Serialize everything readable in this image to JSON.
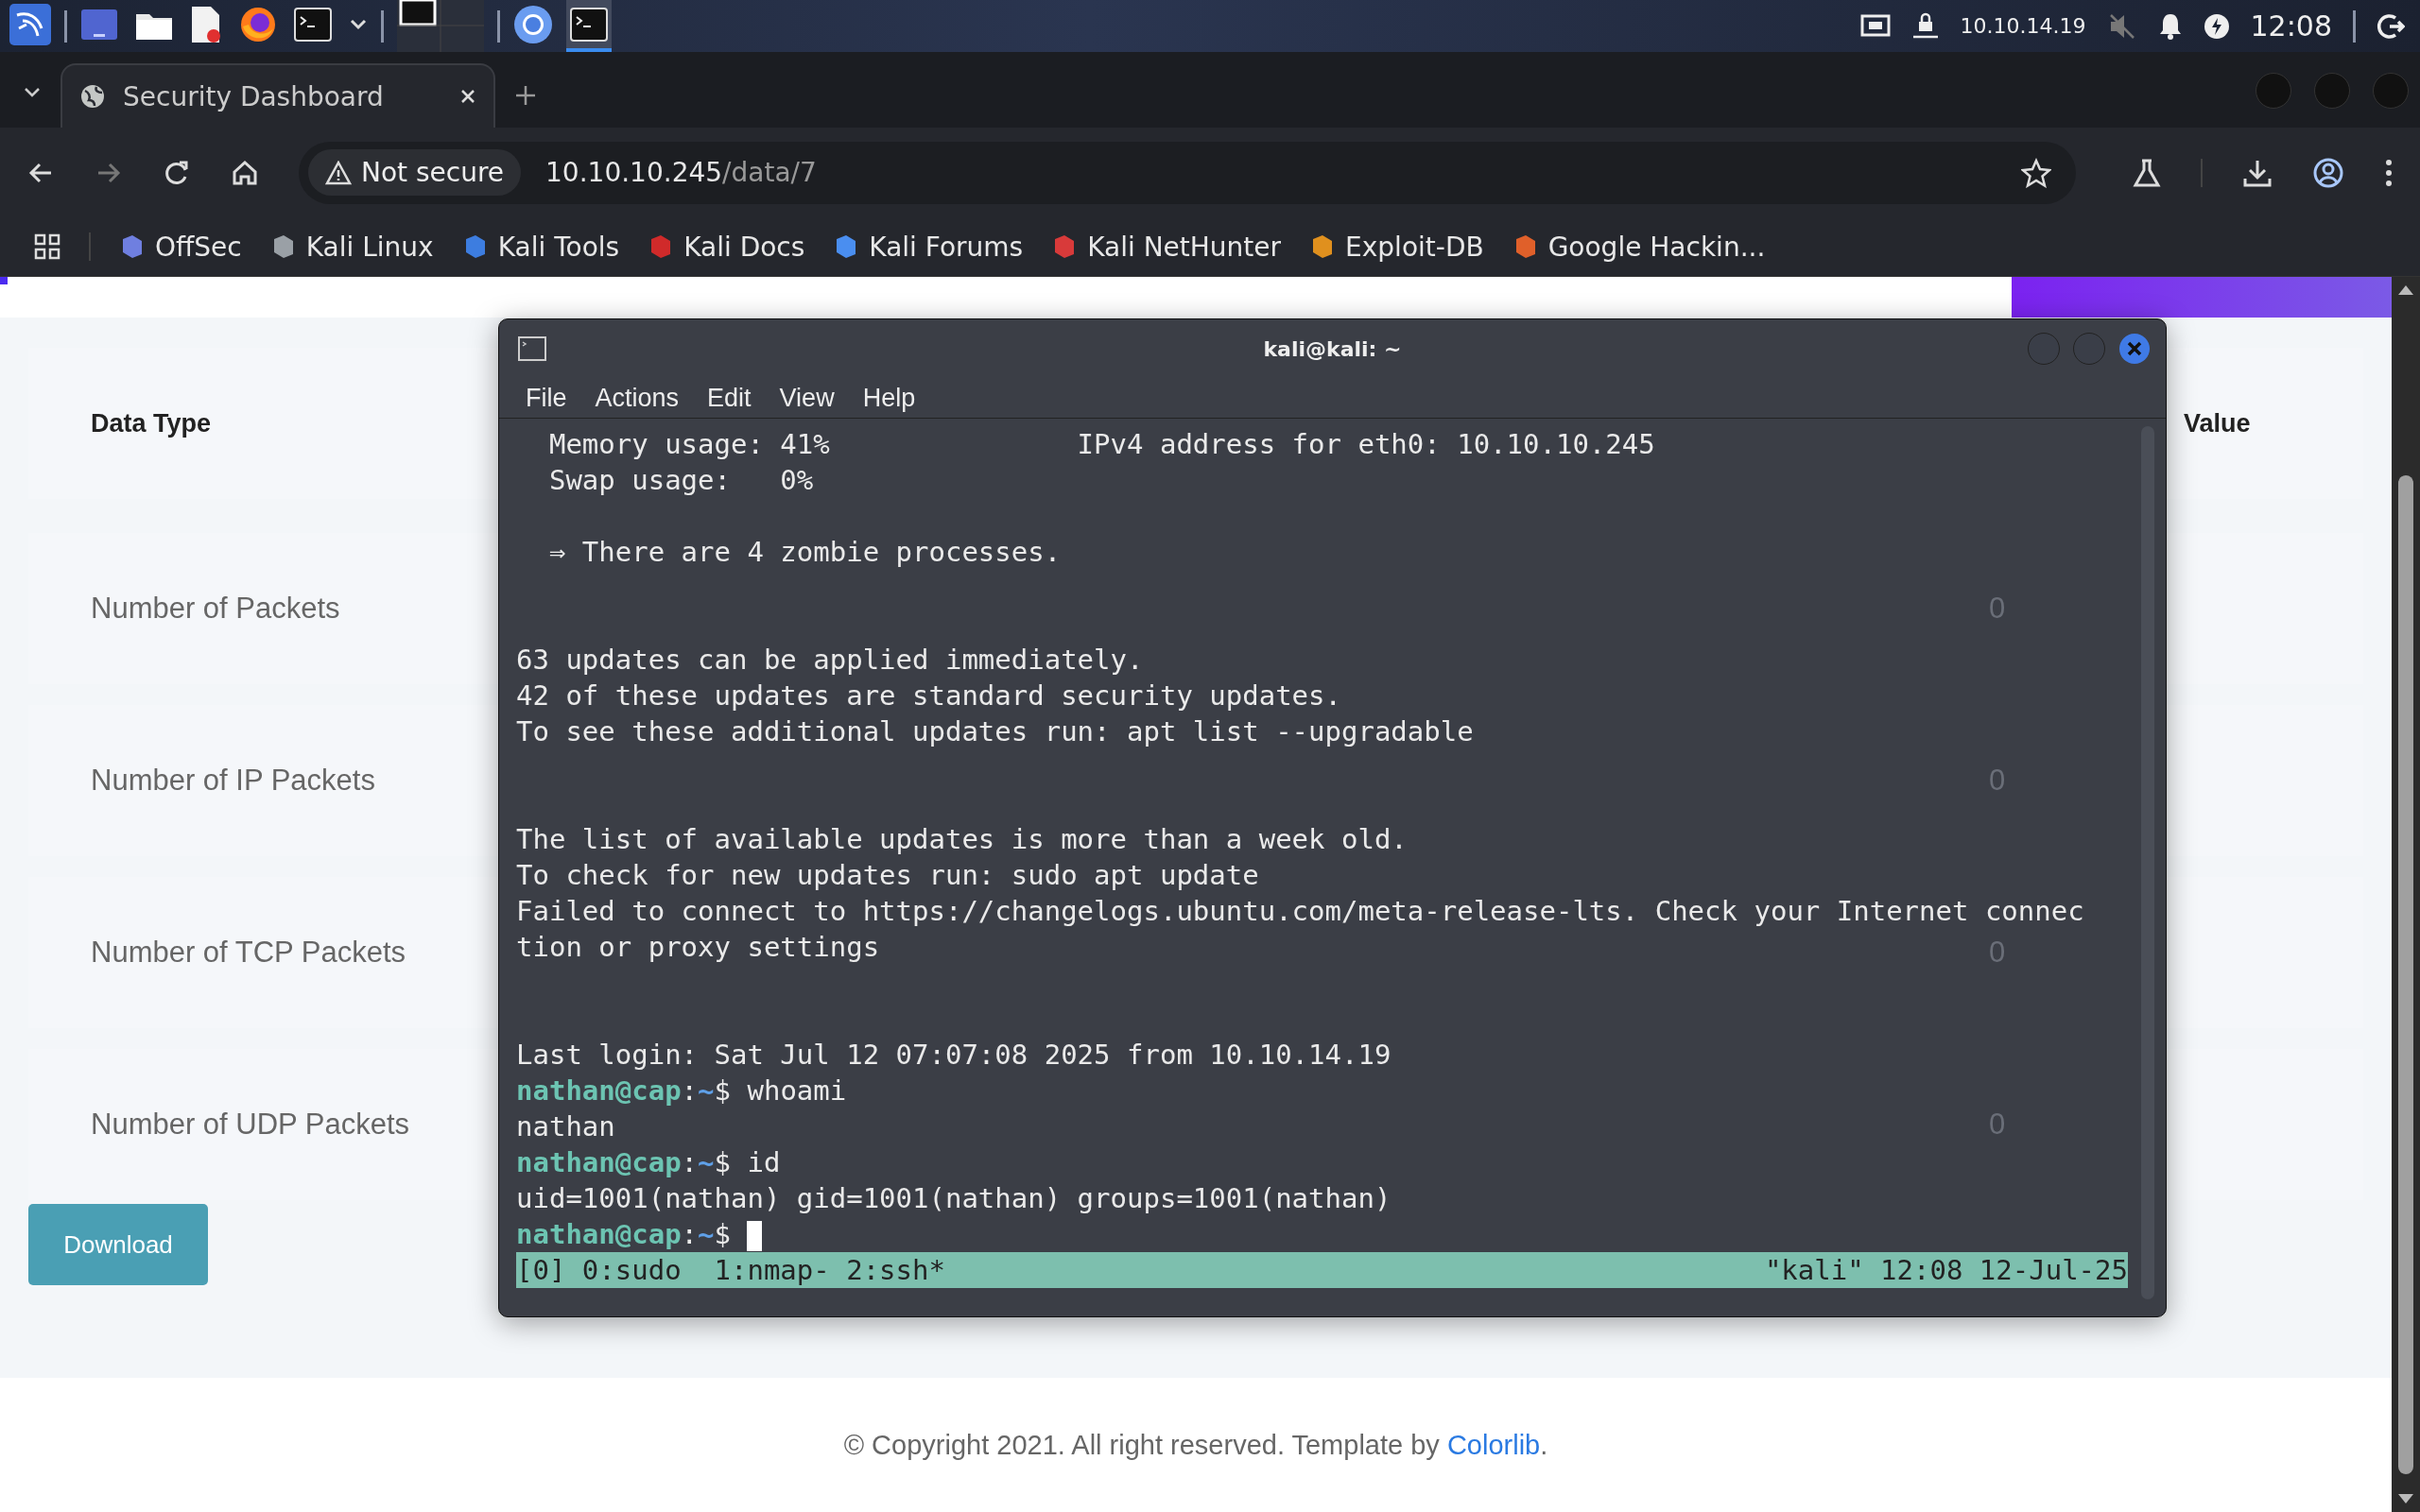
{
  "taskbar": {
    "launchers": [
      {
        "kind": "kali-menu",
        "selected": false
      },
      {
        "kind": "desktop",
        "selected": false
      },
      {
        "kind": "files",
        "selected": false
      },
      {
        "kind": "editor",
        "selected": false
      },
      {
        "kind": "firefox",
        "selected": false
      },
      {
        "kind": "terminal",
        "selected": false
      },
      {
        "kind": "caret",
        "selected": false
      },
      {
        "kind": "workspaces",
        "selected": false
      },
      {
        "kind": "chromium",
        "selected": false
      },
      {
        "kind": "terminal",
        "selected": true
      }
    ],
    "ip": "10.10.14.19",
    "clock": "12:08"
  },
  "browser": {
    "tabs": [
      {
        "title": "Security Dashboard",
        "selected": true
      }
    ],
    "security": "Not secure",
    "url_host": "10.10.10.245",
    "url_path": "/data/7",
    "bookmarks": [
      {
        "label": "OffSec",
        "color": "#6f7fe0"
      },
      {
        "label": "Kali Linux",
        "color": "#9aa0a6"
      },
      {
        "label": "Kali Tools",
        "color": "#3d7de0"
      },
      {
        "label": "Kali Docs",
        "color": "#d02a2a"
      },
      {
        "label": "Kali Forums",
        "color": "#4a8ef0"
      },
      {
        "label": "Kali NetHunter",
        "color": "#d83a3a"
      },
      {
        "label": "Exploit-DB",
        "color": "#e0901e"
      },
      {
        "label": "Google Hackin...",
        "color": "#e0602a"
      }
    ]
  },
  "page": {
    "table": {
      "columns": [
        "Data Type",
        "Value"
      ],
      "rows": [
        {
          "label": "Number of Packets",
          "value": "0"
        },
        {
          "label": "Number of IP Packets",
          "value": "0"
        },
        {
          "label": "Number of TCP Packets",
          "value": "0"
        },
        {
          "label": "Number of UDP Packets",
          "value": "0"
        }
      ]
    },
    "download": "Download",
    "footer": {
      "text": "© Copyright 2021. All right reserved. Template by ",
      "link": "Colorlib",
      "end": "."
    }
  },
  "terminal": {
    "title": "kali@kali: ~",
    "menu": [
      "File",
      "Actions",
      "Edit",
      "View",
      "Help"
    ],
    "lines": [
      {
        "kind": "text",
        "text": "  Memory usage: 41%               IPv4 address for eth0: 10.10.10.245"
      },
      {
        "kind": "text",
        "text": "  Swap usage:   0%"
      },
      {
        "kind": "blank"
      },
      {
        "kind": "text",
        "text": "  ⇒ There are 4 zombie processes."
      },
      {
        "kind": "blank"
      },
      {
        "kind": "blank"
      },
      {
        "kind": "text",
        "text": "63 updates can be applied immediately."
      },
      {
        "kind": "text",
        "text": "42 of these updates are standard security updates."
      },
      {
        "kind": "text",
        "text": "To see these additional updates run: apt list --upgradable"
      },
      {
        "kind": "blank"
      },
      {
        "kind": "blank"
      },
      {
        "kind": "text",
        "text": "The list of available updates is more than a week old."
      },
      {
        "kind": "text",
        "text": "To check for new updates run: sudo apt update"
      },
      {
        "kind": "text",
        "text": "Failed to connect to https://changelogs.ubuntu.com/meta-release-lts. Check your Internet connec"
      },
      {
        "kind": "text",
        "text": "tion or proxy settings"
      },
      {
        "kind": "blank"
      },
      {
        "kind": "blank"
      },
      {
        "kind": "text",
        "text": "Last login: Sat Jul 12 07:07:08 2025 from 10.10.14.19"
      },
      {
        "kind": "prompt",
        "user": "nathan@cap",
        "sep": ":",
        "path": "~",
        "sign": "$",
        "command": " whoami",
        "cursor": false
      },
      {
        "kind": "text",
        "text": "nathan"
      },
      {
        "kind": "prompt",
        "user": "nathan@cap",
        "sep": ":",
        "path": "~",
        "sign": "$",
        "command": " id",
        "cursor": false
      },
      {
        "kind": "text",
        "text": "uid=1001(nathan) gid=1001(nathan) groups=1001(nathan)"
      },
      {
        "kind": "prompt",
        "user": "nathan@cap",
        "sep": ":",
        "path": "~",
        "sign": "$",
        "cursor": true
      }
    ],
    "status_left": "[0] 0:sudo  1:nmap- 2:ssh*",
    "status_right": "\"kali\" 12:08 12-Jul-25"
  }
}
